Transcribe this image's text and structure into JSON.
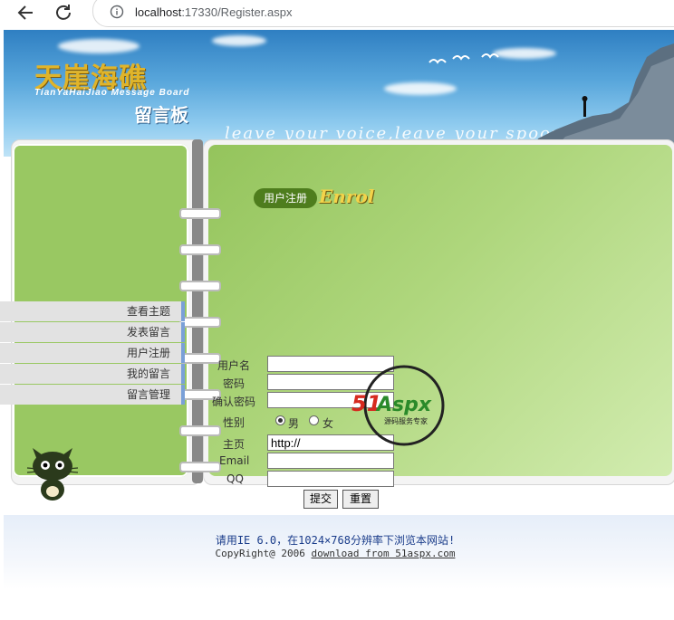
{
  "browser": {
    "url_host": "localhost",
    "url_rest": ":17330/Register.aspx"
  },
  "banner": {
    "title_cn": "天崖海礁",
    "title_en": "TianYaHaiJiao Message Board",
    "subtitle": "留言板",
    "slogan": "leave your voice,leave your spoor"
  },
  "menu": {
    "items": [
      {
        "label": "查看主题"
      },
      {
        "label": "发表留言"
      },
      {
        "label": "用户注册"
      },
      {
        "label": "我的留言"
      },
      {
        "label": "留言管理"
      }
    ]
  },
  "register": {
    "tag_cn": "用户注册",
    "tag_en": "Enrol",
    "username_label": "用户名",
    "password_label": "密码",
    "confirm_label": "确认密码",
    "gender_label": "性别",
    "male": "男",
    "female": "女",
    "homepage_label": "主页",
    "homepage_value": "http://",
    "email_label": "Email",
    "qq_label": "QQ",
    "submit": "提交",
    "reset": "重置"
  },
  "watermark": {
    "brand": "51Aspx",
    "tagline": "源码服务专家"
  },
  "footer": {
    "line1": "请用IE 6.0，在1024×768分辨率下浏览本网站!",
    "line2_prefix": "CopyRight@ 2006 ",
    "line2_link": "download from 51aspx.com"
  },
  "colors": {
    "page_green": "#99c862",
    "accent_blue": "#7aa0d8",
    "footer_text": "#1a3c8a"
  }
}
